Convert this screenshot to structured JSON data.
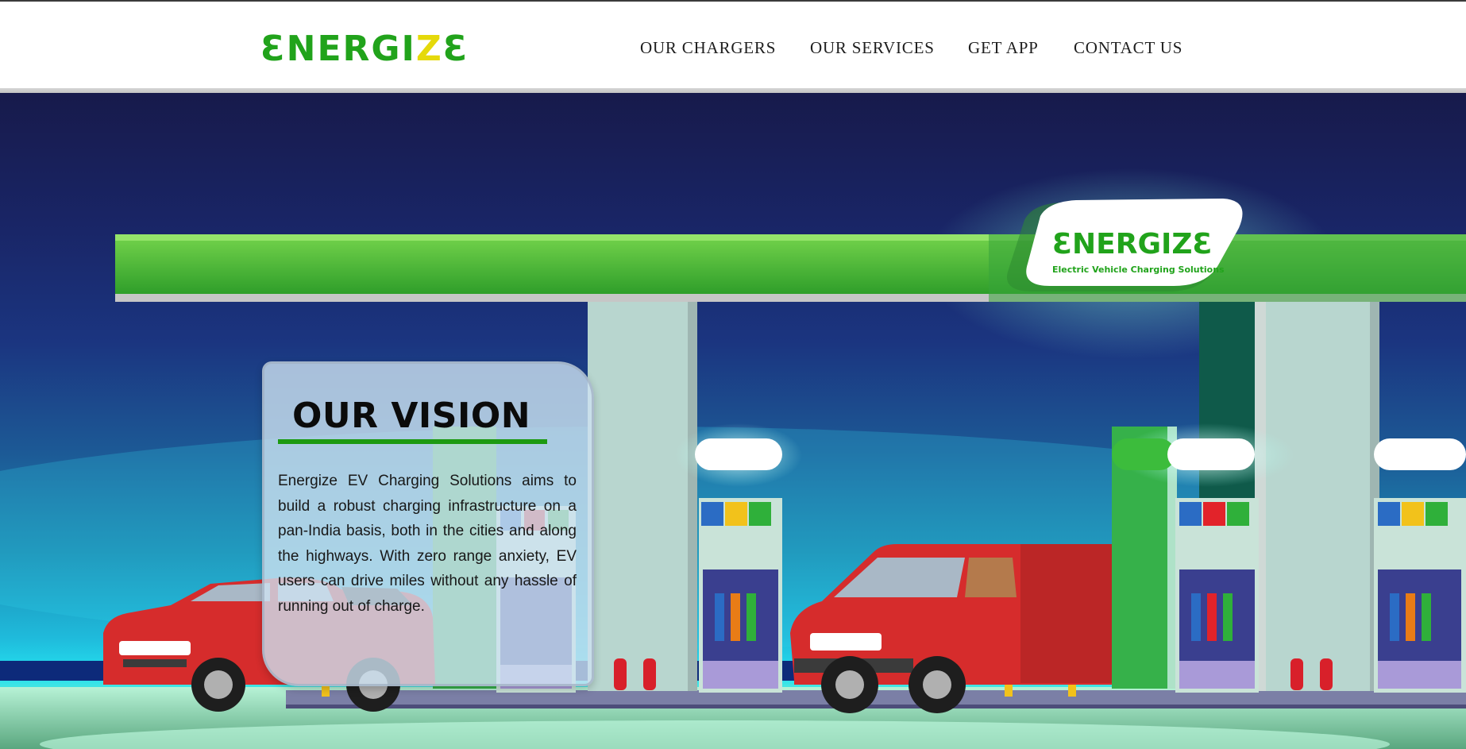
{
  "header": {
    "logo": {
      "text_before": "ƐNERGI",
      "bolt": "Z",
      "text_after": "Ɛ"
    },
    "nav": [
      {
        "label": "OUR CHARGERS"
      },
      {
        "label": "OUR SERVICES"
      },
      {
        "label": "GET APP"
      },
      {
        "label": "CONTACT US"
      }
    ]
  },
  "hero": {
    "station_logo": "ƐNERGIZƐ",
    "station_tagline": "Electric Vehicle Charging Solutions",
    "vision": {
      "title": "OUR VISION",
      "text": "Energize EV Charging Solutions aims to build a robust charging infrastructure on a pan-India basis, both in the cities and along the highways. With zero range anxiety, EV users can drive miles without any hassle of running out of charge."
    }
  },
  "colors": {
    "brand_green": "#21a31b",
    "bolt_yellow": "#e5d90a",
    "sky_top": "#171a4b",
    "sky_glow": "#25e2f0"
  }
}
